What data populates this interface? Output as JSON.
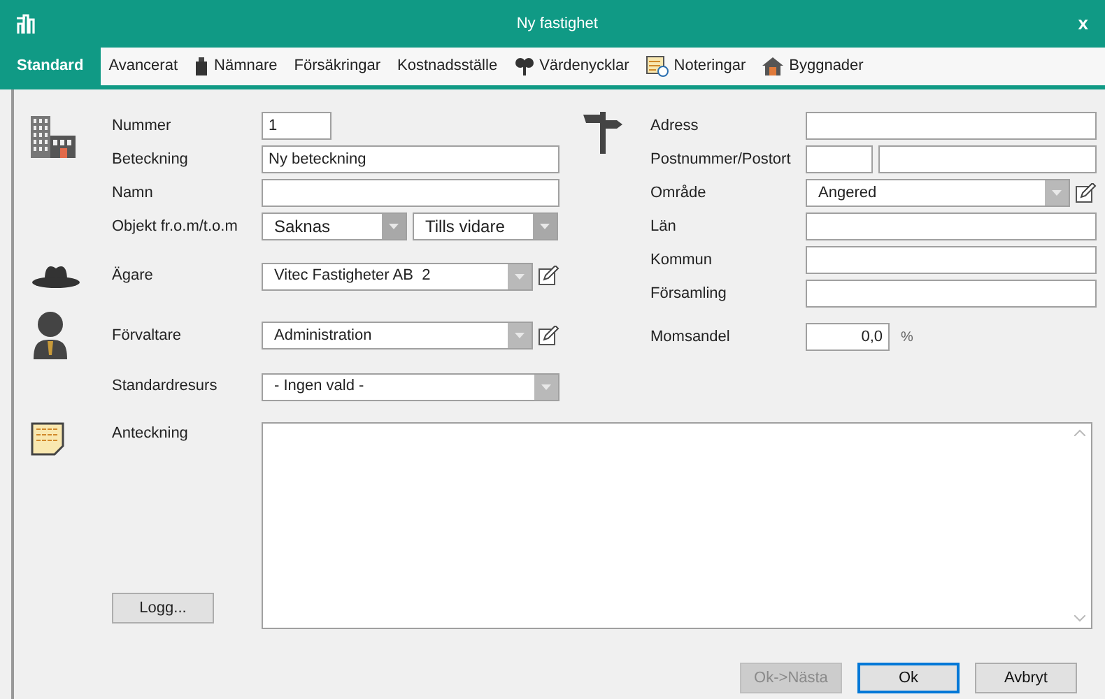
{
  "window": {
    "title": "Ny fastighet",
    "close": "x"
  },
  "tabs": [
    {
      "label": "Standard",
      "selected": true,
      "kind": "plain"
    },
    {
      "label": "Avancerat",
      "selected": false,
      "kind": "plain"
    },
    {
      "label": "Nämnare",
      "selected": false,
      "kind": "weight"
    },
    {
      "label": "Försäkringar",
      "selected": false,
      "kind": "plain"
    },
    {
      "label": "Kostnadsställe",
      "selected": false,
      "kind": "plain"
    },
    {
      "label": "Värdenycklar",
      "selected": false,
      "kind": "key"
    },
    {
      "label": "Noteringar",
      "selected": false,
      "kind": "notes"
    },
    {
      "label": "Byggnader",
      "selected": false,
      "kind": "house"
    }
  ],
  "left_fields": [
    {
      "label": "Nummer",
      "kind": "short",
      "value": "1"
    },
    {
      "label": "Beteckning",
      "kind": "text",
      "value": "Ny beteckning"
    },
    {
      "label": "Namn",
      "kind": "text"
    },
    {
      "label": "Objekt fr.o.m/t.o.m",
      "kind": "combo_pair",
      "values": [
        "Saknas",
        "Tills vidare"
      ]
    },
    {
      "label": "Ägare",
      "kind": "combo_edit",
      "value": "Vitec Fastigheter AB  2"
    },
    {
      "label": "Förvaltare",
      "kind": "combo_edit",
      "value": "Administration"
    },
    {
      "label": "Standardresurs",
      "kind": "combo",
      "value": "- Ingen vald -"
    }
  ],
  "right_fields": [
    {
      "label": "Adress",
      "kind": "text"
    },
    {
      "label": "Postnummer/Postort",
      "kind": "postal_pair"
    },
    {
      "label": "Område",
      "kind": "combo_edit",
      "value": "Angered"
    },
    {
      "label": "Län",
      "kind": "text"
    },
    {
      "label": "Kommun",
      "kind": "text"
    },
    {
      "label": "Församling",
      "kind": "text"
    },
    {
      "label": "Momsandel",
      "kind": "number",
      "value": "0,0",
      "unit": "%"
    }
  ],
  "note": {
    "label": "Anteckning",
    "log_button": "Logg..."
  },
  "buttons": [
    {
      "label": "Ok->Nästa",
      "disabled": true,
      "selected": false
    },
    {
      "label": "Ok",
      "disabled": false,
      "selected": true
    },
    {
      "label": "Avbryt",
      "disabled": false,
      "selected": false
    }
  ]
}
